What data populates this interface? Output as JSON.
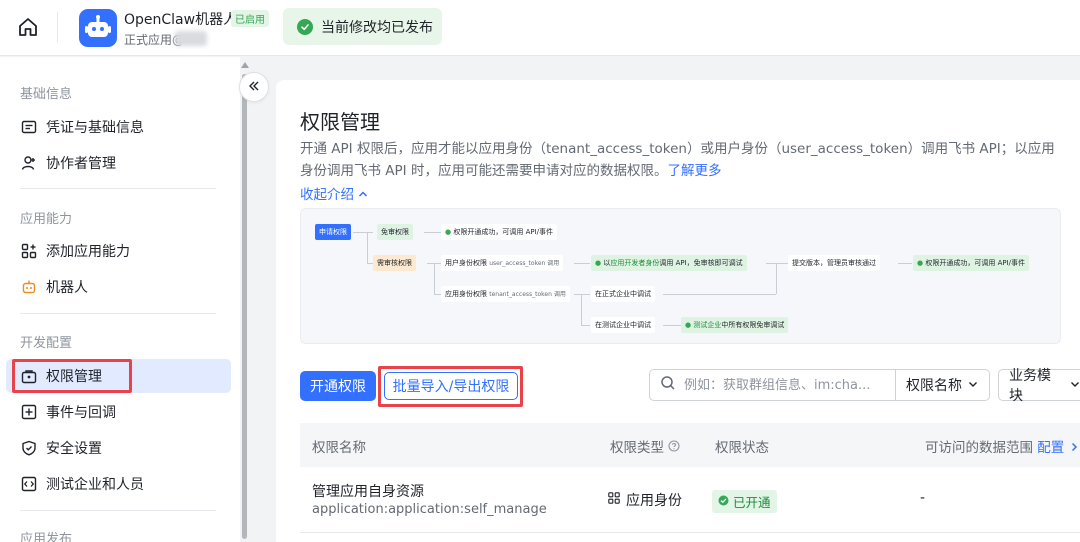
{
  "header": {
    "app_name": "OpenClaw机器人",
    "app_status_badge": "已启用",
    "app_subtitle": "正式应用@",
    "toast_text": "当前修改均已发布"
  },
  "sidebar": {
    "sections": [
      {
        "title": "基础信息",
        "items": [
          "凭证与基础信息",
          "协作者管理"
        ]
      },
      {
        "title": "应用能力",
        "items": [
          "添加应用能力",
          "机器人"
        ]
      },
      {
        "title": "开发配置",
        "items": [
          "权限管理",
          "事件与回调",
          "安全设置",
          "测试企业和人员"
        ]
      },
      {
        "title": "应用发布",
        "items": []
      }
    ],
    "active_item": "权限管理"
  },
  "main": {
    "title": "权限管理",
    "description": "开通 API 权限后，应用才能以应用身份（tenant_access_token）或用户身份（user_access_token）调用飞书 API；以应用身份调用飞书 API 时，应用可能还需要申请对应的数据权限。",
    "learn_more": "了解更多",
    "collapse_intro": "收起介绍",
    "flow": {
      "apply": "申请权限",
      "no_review": "免审权限",
      "no_review_result": "权限开通成功，可调用 API/事件",
      "need_review": "需审核权限",
      "user_identity": "用户身份权限",
      "user_token": "user_access_token 调用",
      "user_result_pre": "以",
      "user_result_highlight": "应用开发者身份",
      "user_result_post": "调用 API，免审核即可调试",
      "submit": "提交版本，管理员审核通过",
      "final_result": "权限开通成功，可调用 API/事件",
      "app_identity": "应用身份权限",
      "tenant_token": "tenant_access_token 调用",
      "prod_debug": "在正式企业中调试",
      "test_debug": "在测试企业中调试",
      "test_result_highlight": "测试企业",
      "test_result_post": "中所有权限免审调试"
    },
    "toolbar": {
      "enable_button": "开通权限",
      "batch_button": "批量导入/导出权限",
      "search_placeholder": "例如：获取群组信息、im:cha...",
      "filter_select": "权限名称",
      "module_select": "业务模块"
    },
    "table": {
      "columns": [
        "权限名称",
        "权限类型",
        "权限状态",
        "可访问的数据范围"
      ],
      "config_link": "配置",
      "rows": [
        {
          "name": "管理应用自身资源",
          "code": "application:application:self_manage",
          "type": "应用身份",
          "status": "已开通",
          "scope": "-"
        }
      ]
    }
  },
  "colors": {
    "accent": "#3370ff",
    "success": "#34a853",
    "highlight_red": "#e8434a"
  }
}
